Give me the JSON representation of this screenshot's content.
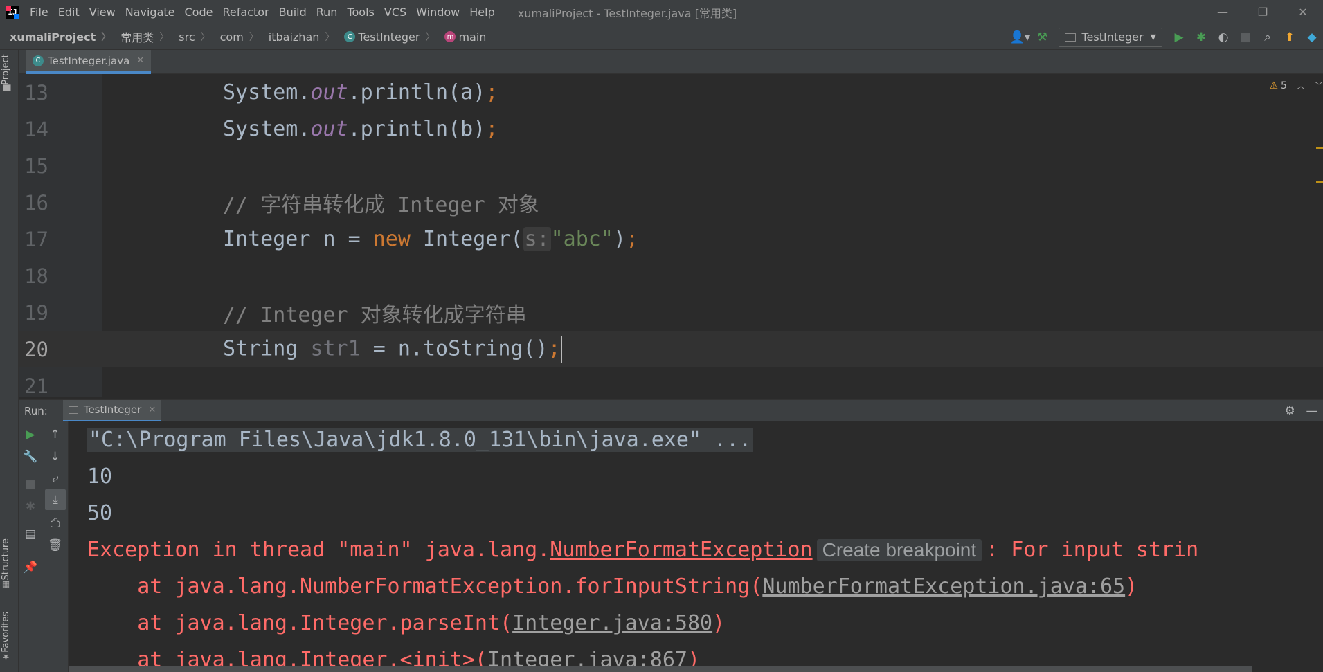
{
  "menubar": {
    "logo": "IJ",
    "items": [
      "File",
      "Edit",
      "View",
      "Navigate",
      "Code",
      "Refactor",
      "Build",
      "Run",
      "Tools",
      "VCS",
      "Window",
      "Help"
    ],
    "window_title": "xumaliProject - TestInteger.java [常用类]",
    "controls": {
      "minimize": "—",
      "restore": "❐",
      "close": "✕"
    }
  },
  "navbar": {
    "breadcrumbs": [
      "xumaliProject",
      "常用类",
      "src",
      "com",
      "itbaizhan",
      "TestInteger",
      "main"
    ],
    "run_config": "TestInteger",
    "icons": [
      "user-icon",
      "build-hammer-icon",
      "run-icon",
      "debug-icon",
      "coverage-icon",
      "stop-icon",
      "search-icon",
      "update-icon",
      "plugin-icon"
    ]
  },
  "left_strip": {
    "project": "Project",
    "structure": "Structure",
    "favorites": "Favorites"
  },
  "editor_tab": {
    "label": "TestInteger.java",
    "close": "✕"
  },
  "inspection": {
    "warning_icon": "⚠",
    "count": "5"
  },
  "editor": {
    "line_numbers": [
      "13",
      "14",
      "15",
      "16",
      "17",
      "18",
      "19",
      "20",
      "21"
    ],
    "current_line": "20",
    "code": {
      "l13": {
        "a": "System.",
        "b": "out",
        "c": ".println(a)",
        "d": ";"
      },
      "l14": {
        "a": "System.",
        "b": "out",
        "c": ".println(b)",
        "d": ";"
      },
      "l16": {
        "a": "// 字符串转化成 Integer 对象"
      },
      "l17": {
        "a": "Integer n = ",
        "b": "new",
        "c": " Integer(",
        "hint": "s:",
        "str": "\"abc\"",
        "d": ")",
        "e": ";"
      },
      "l19": {
        "a": "// Integer 对象转化成字符串"
      },
      "l20": {
        "a": "String ",
        "b": "str1",
        "c": " = n.toString()",
        "d": ";"
      }
    }
  },
  "run": {
    "label": "Run:",
    "tab": "TestInteger",
    "tab_close": "✕",
    "console": {
      "cmd": "\"C:\\Program Files\\Java\\jdk1.8.0_131\\bin\\java.exe\" ...",
      "out1": "10",
      "out2": "50",
      "exc_prefix": "Exception in thread \"main\" java.lang.",
      "exc_class": "NumberFormatException",
      "bp_hint": "Create breakpoint",
      "exc_suffix": ": For input strin",
      "st1_prefix": "    at java.lang.NumberFormatException.forInputString(",
      "st1_link": "NumberFormatException.java:65",
      "st1_suffix": ")",
      "st2_prefix": "    at java.lang.Integer.parseInt(",
      "st2_link": "Integer.java:580",
      "st2_suffix": ")",
      "st3_prefix": "    at java.lang.Integer.<init>(",
      "st3_link": "Integer.java:867",
      "st3_suffix": ")"
    }
  },
  "colors": {
    "background": "#2b2b2b",
    "panel": "#3c3f41",
    "keyword": "#cc7832",
    "field": "#9876aa",
    "string": "#6a8759",
    "comment": "#808080",
    "error": "#ff6b68",
    "accent": "#4a88c7"
  }
}
